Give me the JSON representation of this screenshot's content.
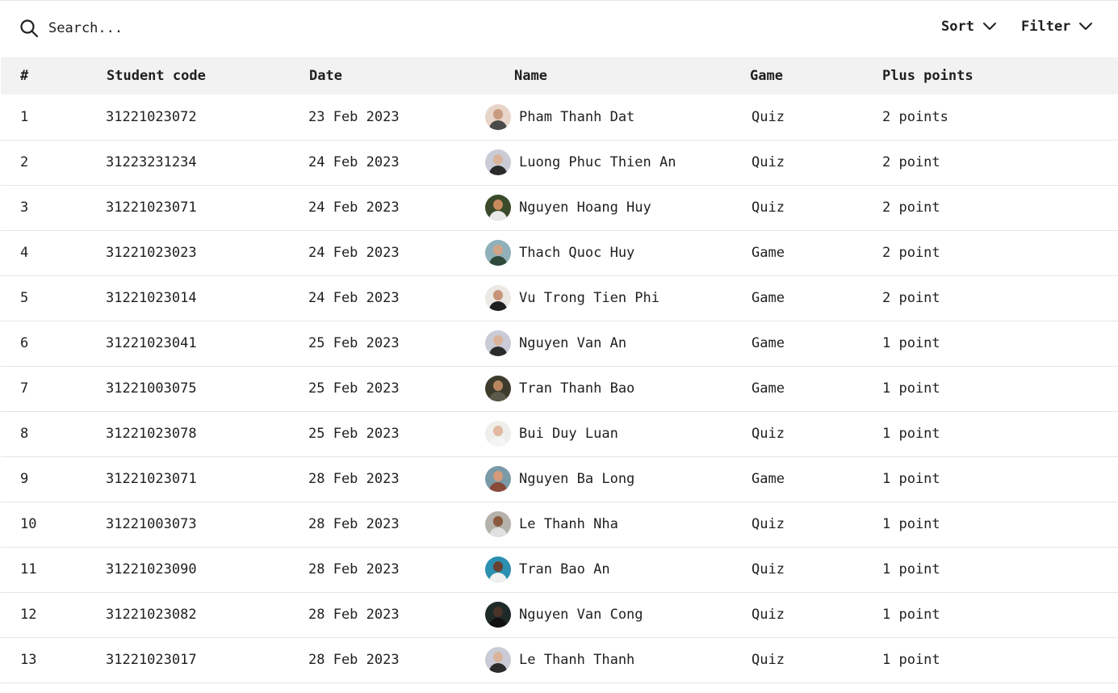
{
  "toolbar": {
    "search_placeholder": "Search...",
    "sort_label": "Sort",
    "filter_label": "Filter"
  },
  "table": {
    "headers": {
      "index": "#",
      "student_code": "Student code",
      "date": "Date",
      "name": "Name",
      "game": "Game",
      "plus_points": "Plus points"
    },
    "rows": [
      {
        "index": "1",
        "code": "31221023072",
        "date": "23 Feb 2023",
        "name": "Pham Thanh Dat",
        "game": "Quiz",
        "points": "2 points",
        "avatar_bg": "#e8d5c9",
        "avatar_skin": "#c89c80",
        "avatar_shirt": "#4a4a4a"
      },
      {
        "index": "2",
        "code": "31223231234",
        "date": "24 Feb 2023",
        "name": "Luong Phuc Thien An",
        "game": "Quiz",
        "points": "2 point",
        "avatar_bg": "#c9ccd6",
        "avatar_skin": "#d9b49a",
        "avatar_shirt": "#2b2b2b"
      },
      {
        "index": "3",
        "code": "31221023071",
        "date": "24 Feb 2023",
        "name": "Nguyen Hoang Huy",
        "game": "Quiz",
        "points": "2 point",
        "avatar_bg": "#3a4a2a",
        "avatar_skin": "#c98a5f",
        "avatar_shirt": "#e8e8e8"
      },
      {
        "index": "4",
        "code": "31221023023",
        "date": "24 Feb 2023",
        "name": "Thach Quoc Huy",
        "game": "Game",
        "points": "2 point",
        "avatar_bg": "#8fb0b8",
        "avatar_skin": "#d2a487",
        "avatar_shirt": "#2f4a3a"
      },
      {
        "index": "5",
        "code": "31221023014",
        "date": "24 Feb 2023",
        "name": "Vu Trong Tien Phi",
        "game": "Game",
        "points": "2 point",
        "avatar_bg": "#ece8e3",
        "avatar_skin": "#c8957a",
        "avatar_shirt": "#1f1f1f"
      },
      {
        "index": "6",
        "code": "31221023041",
        "date": "25 Feb 2023",
        "name": "Nguyen Van An",
        "game": "Game",
        "points": "1 point",
        "avatar_bg": "#c9ccd6",
        "avatar_skin": "#d9b49a",
        "avatar_shirt": "#2b2b2b"
      },
      {
        "index": "7",
        "code": "31221003075",
        "date": "25 Feb 2023",
        "name": "Tran Thanh Bao",
        "game": "Game",
        "points": "1 point",
        "avatar_bg": "#3d3b2c",
        "avatar_skin": "#b8865e",
        "avatar_shirt": "#5a5a4a"
      },
      {
        "index": "8",
        "code": "31221023078",
        "date": "25 Feb 2023",
        "name": "Bui Duy Luan",
        "game": "Quiz",
        "points": "1 point",
        "avatar_bg": "#eeeeea",
        "avatar_skin": "#e0b9a0",
        "avatar_shirt": "#f5f5f5"
      },
      {
        "index": "9",
        "code": "31221023071",
        "date": "28 Feb 2023",
        "name": "Nguyen Ba Long",
        "game": "Game",
        "points": "1 point",
        "avatar_bg": "#7a9aa8",
        "avatar_skin": "#d49a7a",
        "avatar_shirt": "#8a4a3a"
      },
      {
        "index": "10",
        "code": "31221003073",
        "date": "28 Feb 2023",
        "name": "Le Thanh Nha",
        "game": "Quiz",
        "points": "1 point",
        "avatar_bg": "#b5b2ab",
        "avatar_skin": "#8a5a3e",
        "avatar_shirt": "#e0e0e0"
      },
      {
        "index": "11",
        "code": "31221023090",
        "date": "28 Feb 2023",
        "name": "Tran Bao An",
        "game": "Quiz",
        "points": "1 point",
        "avatar_bg": "#2a8fb0",
        "avatar_skin": "#6a4030",
        "avatar_shirt": "#f0f0f0"
      },
      {
        "index": "12",
        "code": "31221023082",
        "date": "28 Feb 2023",
        "name": "Nguyen Van Cong",
        "game": "Quiz",
        "points": "1 point",
        "avatar_bg": "#1e2a28",
        "avatar_skin": "#4a3428",
        "avatar_shirt": "#111111"
      },
      {
        "index": "13",
        "code": "31221023017",
        "date": "28 Feb 2023",
        "name": "Le Thanh Thanh",
        "game": "Quiz",
        "points": "1 point",
        "avatar_bg": "#c9ccd6",
        "avatar_skin": "#d9b49a",
        "avatar_shirt": "#2b2b2b"
      }
    ]
  }
}
